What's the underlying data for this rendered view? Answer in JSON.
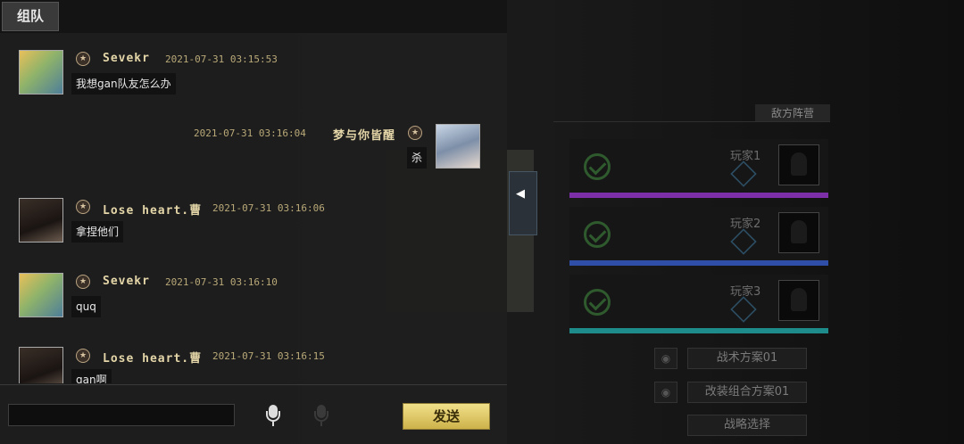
{
  "panel": {
    "title": "组队",
    "send_label": "发送",
    "input_value": ""
  },
  "messages": [
    {
      "name": "Sevekr",
      "time": "2021-07-31 03:15:53",
      "text": "我想gan队友怎么办",
      "side": "left",
      "avatar": "sevekr-avatar"
    },
    {
      "name": "梦与你皆醒",
      "time": "2021-07-31 03:16:04",
      "text": "杀",
      "side": "right",
      "avatar": "dream-avatar"
    },
    {
      "name": "Lose heart.曹",
      "time": "2021-07-31 03:16:06",
      "text": "拿捏他们",
      "side": "left",
      "avatar": "lose-heart-avatar"
    },
    {
      "name": "Sevekr",
      "time": "2021-07-31 03:16:10",
      "text": "quq",
      "side": "left",
      "avatar": "sevekr-avatar"
    },
    {
      "name": "Lose heart.曹",
      "time": "2021-07-31 03:16:15",
      "text": "gan啊",
      "side": "left",
      "avatar": "lose-heart-avatar"
    }
  ],
  "background": {
    "enemy_title": "敌方阵营",
    "players": [
      {
        "name": "玩家1",
        "bar_color": "#7c2fa8"
      },
      {
        "name": "玩家2",
        "bar_color": "#2e4ea8"
      },
      {
        "name": "玩家3",
        "bar_color": "#1f8c8c"
      }
    ],
    "plans": [
      "战术方案01",
      "改装组合方案01",
      "战略选择"
    ]
  },
  "colors": {
    "accent_gold": "#e4d6a8",
    "send_button": "#e6cf6a"
  }
}
